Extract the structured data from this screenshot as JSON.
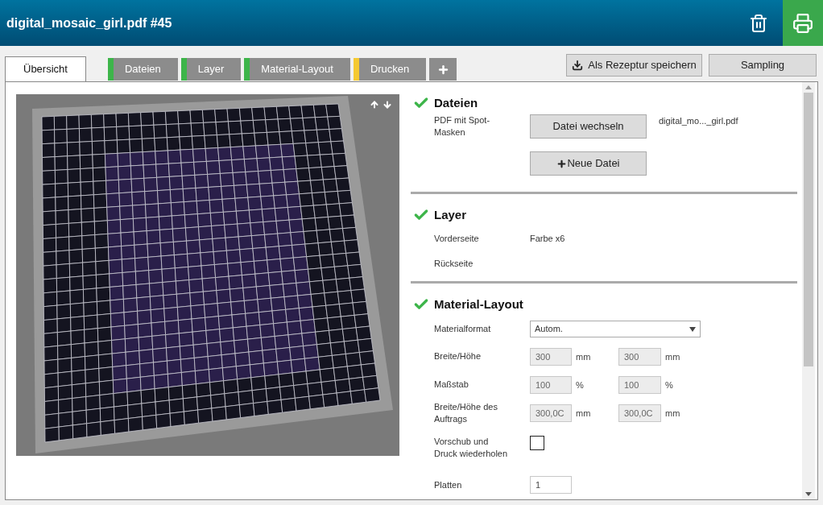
{
  "window": {
    "title": "digital_mosaic_girl.pdf #45"
  },
  "tabs": [
    {
      "label": "Übersicht",
      "selected": true
    },
    {
      "label": "Dateien",
      "selected": false,
      "color": "#3db54a"
    },
    {
      "label": "Layer",
      "selected": false,
      "color": "#3db54a"
    },
    {
      "label": "Material-Layout",
      "selected": false,
      "color": "#3db54a"
    },
    {
      "label": "Drucken",
      "selected": false,
      "color": "#f5c931"
    }
  ],
  "toolbar_buttons": [
    {
      "label": "Als Rezeptur speichern",
      "kind": "download"
    },
    {
      "label": "Sampling",
      "kind": "plain"
    }
  ],
  "sections": [
    {
      "title": "Dateien",
      "done": true,
      "rows": [
        {
          "kind": "file",
          "label": "PDF mit Spot-Masken",
          "button": "Datei wechseln",
          "value": "digital_mo..._girl.pdf"
        },
        {
          "kind": "add",
          "button": "Neue Datei"
        }
      ]
    },
    {
      "title": "Layer",
      "done": true,
      "rows": [
        {
          "kind": "text",
          "label": "Vorderseite",
          "value": "Farbe x6"
        },
        {
          "kind": "text",
          "label": "Rückseite"
        }
      ]
    },
    {
      "title": "Material-Layout",
      "done": true,
      "rows": [
        {
          "kind": "select",
          "label": "Materialformat",
          "value": "Autom."
        },
        {
          "kind": "pair",
          "label": "Breite/Höhe",
          "a": "300",
          "unit_a": "mm",
          "b": "300",
          "unit_b": "mm"
        },
        {
          "kind": "pair",
          "label": "Maßstab",
          "a": "100",
          "unit_a": "%",
          "b": "100",
          "unit_b": "%"
        },
        {
          "kind": "pair",
          "label": "Breite/Höhe des Auftrags",
          "a": "300,0C",
          "unit_a": "mm",
          "b": "300,0C",
          "unit_b": "mm"
        },
        {
          "kind": "checkbox",
          "label": "Vorschub und Druck wiederholen",
          "checked": false
        },
        {
          "kind": "input",
          "label": "Platten",
          "value": "1"
        }
      ]
    }
  ]
}
